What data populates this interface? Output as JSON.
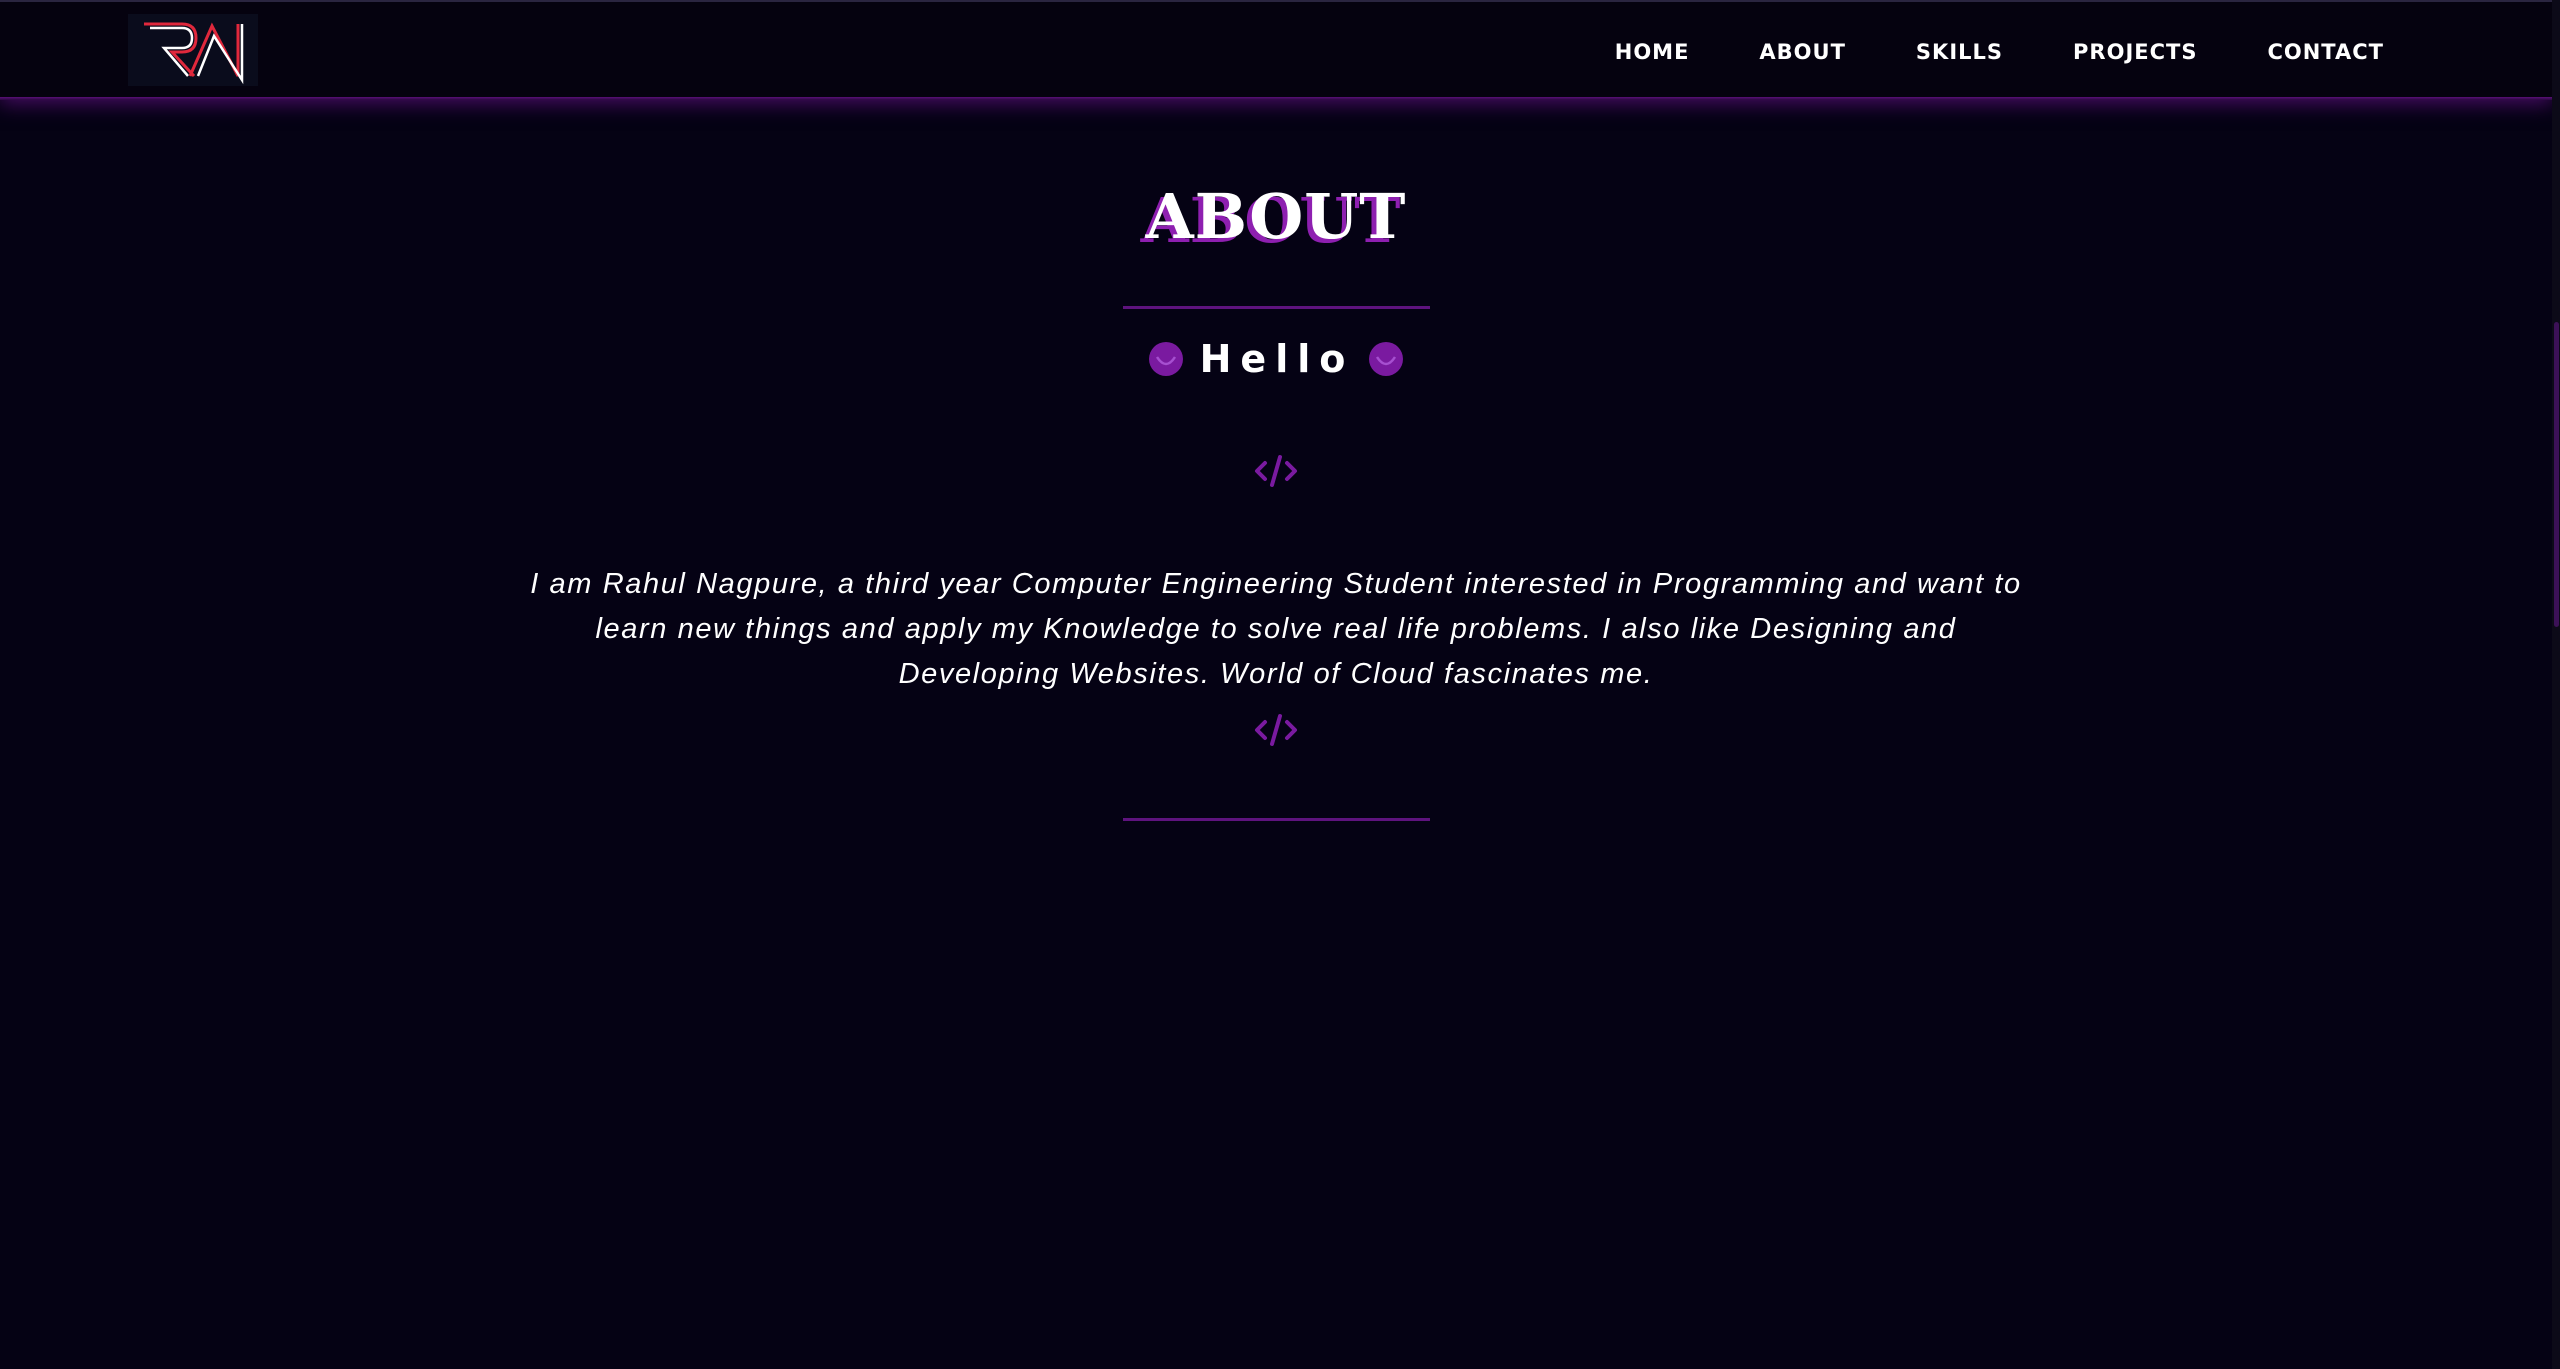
{
  "nav": {
    "logo_text": "RN",
    "items": [
      {
        "label": "HOME"
      },
      {
        "label": "ABOUT"
      },
      {
        "label": "SKILLS"
      },
      {
        "label": "PROJECTS"
      },
      {
        "label": "CONTACT"
      }
    ]
  },
  "about": {
    "title": "ABOUT",
    "greeting": "Hello",
    "description": "I am Rahul Nagpure, a third year Computer Engineering Student interested in Programming and want to learn new things and apply my Knowledge to solve real life problems. I also like Designing and Developing Websites. World of Cloud fascinates me."
  },
  "icons": {
    "greeting_left": "smiley-icon",
    "greeting_right": "smiley-icon",
    "code_top": "code-icon",
    "code_bottom": "code-icon"
  },
  "colors": {
    "background": "#050214",
    "accent": "#7a1aa0",
    "title_shadow": "#8e1fb0",
    "text": "#ffffff",
    "logo_red": "#e0283c"
  }
}
